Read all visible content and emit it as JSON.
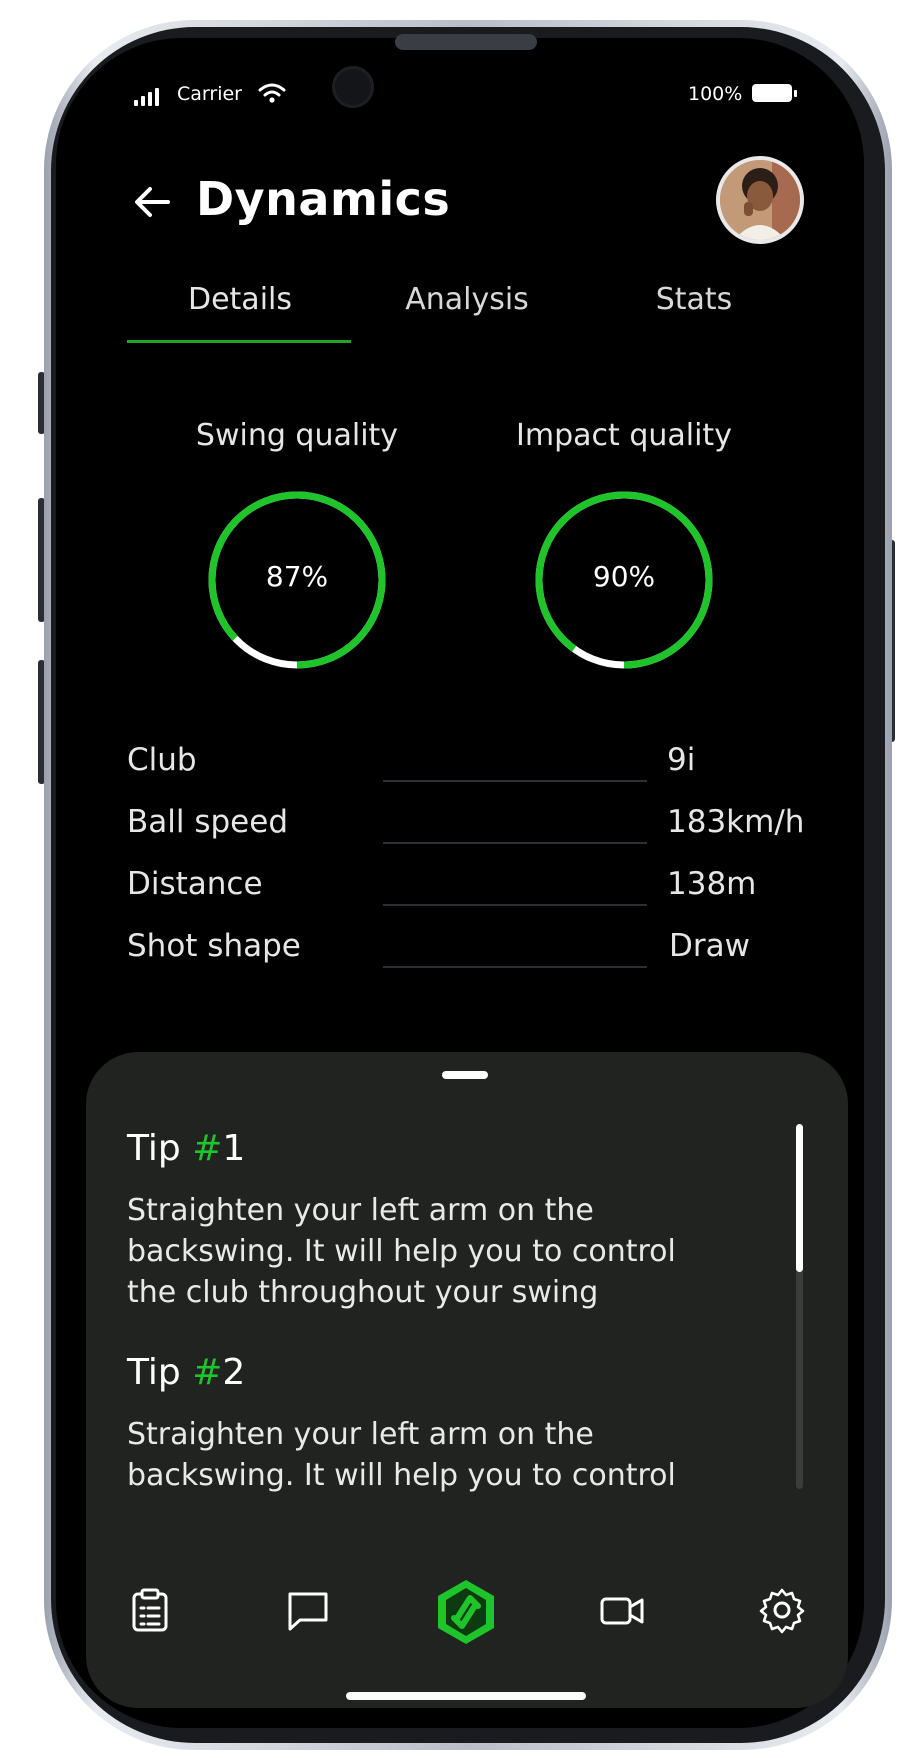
{
  "status_bar": {
    "carrier": "Carrier",
    "battery": "100%"
  },
  "header": {
    "title": "Dynamics"
  },
  "tabs": [
    {
      "label": "Details",
      "active": true
    },
    {
      "label": "Analysis",
      "active": false
    },
    {
      "label": "Stats",
      "active": false
    }
  ],
  "gauges": [
    {
      "label": "Swing quality",
      "value_text": "87%",
      "value": 0.87
    },
    {
      "label": "Impact quality",
      "value_text": "90%",
      "value": 0.9
    }
  ],
  "details": [
    {
      "label": "Club",
      "value": "9i"
    },
    {
      "label": "Ball speed",
      "value": "183km/h"
    },
    {
      "label": "Distance",
      "value": "138m"
    },
    {
      "label": "Shot shape",
      "value": "Draw"
    }
  ],
  "tips": [
    {
      "prefix": "Tip ",
      "hash": "#",
      "number": "1",
      "text": "Straighten your left arm on the backswing. It will help you to control the club throughout your swing"
    },
    {
      "prefix": "Tip ",
      "hash": "#",
      "number": "2",
      "text": "Straighten your left arm on the backswing. It will help you to control"
    }
  ],
  "bottom_nav": [
    "clipboard-icon",
    "chat-icon",
    "app-logo-icon",
    "video-camera-icon",
    "gear-icon"
  ],
  "colors": {
    "accent": "#1ec42a",
    "background": "#000000",
    "sheet": "#202320",
    "gauge_remainder": "#ffffff"
  }
}
